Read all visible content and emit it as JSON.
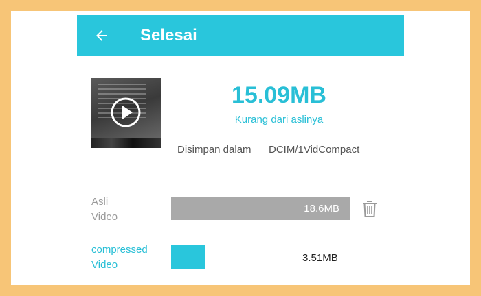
{
  "header": {
    "title": "Selesai",
    "back_icon": "arrow-left-icon",
    "background_color": "#29c6dc"
  },
  "result": {
    "compressed_size": "15.09MB",
    "subtitle": "Kurang dari aslinya",
    "accent_color": "#29bfd6"
  },
  "saved": {
    "label": "Disimpan dalam",
    "path": "DCIM/1VidCompact"
  },
  "comparison": {
    "original": {
      "label_line1": "Asli",
      "label_line2": "Video",
      "size": "18.6MB",
      "bar_fraction": 1.0,
      "bar_color": "#a9a9a9",
      "action_icon": "trash-icon"
    },
    "compressed": {
      "label_line1": "compressed",
      "label_line2": "Video",
      "size": "3.51MB",
      "bar_fraction": 0.19,
      "bar_color": "#29c6dc"
    }
  },
  "thumbnail": {
    "icon": "play-icon"
  }
}
